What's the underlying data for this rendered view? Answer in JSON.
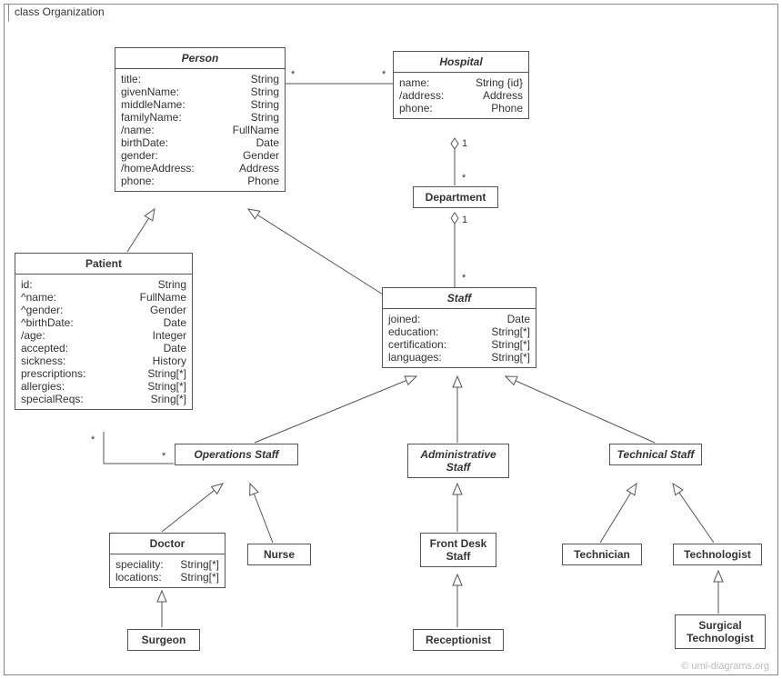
{
  "frame_label": "class Organization",
  "watermark": "© uml-diagrams.org",
  "classes": {
    "person": {
      "name": "Person",
      "attrs": [
        {
          "k": "title:",
          "v": "String"
        },
        {
          "k": "givenName:",
          "v": "String"
        },
        {
          "k": "middleName:",
          "v": "String"
        },
        {
          "k": "familyName:",
          "v": "String"
        },
        {
          "k": "/name:",
          "v": "FullName"
        },
        {
          "k": "birthDate:",
          "v": "Date"
        },
        {
          "k": "gender:",
          "v": "Gender"
        },
        {
          "k": "/homeAddress:",
          "v": "Address"
        },
        {
          "k": "phone:",
          "v": "Phone"
        }
      ]
    },
    "hospital": {
      "name": "Hospital",
      "attrs": [
        {
          "k": "name:",
          "v": "String {id}"
        },
        {
          "k": "/address:",
          "v": "Address"
        },
        {
          "k": "phone:",
          "v": "Phone"
        }
      ]
    },
    "department": {
      "name": "Department"
    },
    "patient": {
      "name": "Patient",
      "attrs": [
        {
          "k": "id:",
          "v": "String"
        },
        {
          "k": "^name:",
          "v": "FullName"
        },
        {
          "k": "^gender:",
          "v": "Gender"
        },
        {
          "k": "^birthDate:",
          "v": "Date"
        },
        {
          "k": "/age:",
          "v": "Integer"
        },
        {
          "k": "accepted:",
          "v": "Date"
        },
        {
          "k": "sickness:",
          "v": "History"
        },
        {
          "k": "prescriptions:",
          "v": "String[*]"
        },
        {
          "k": "allergies:",
          "v": "String[*]"
        },
        {
          "k": "specialReqs:",
          "v": "Sring[*]"
        }
      ]
    },
    "staff": {
      "name": "Staff",
      "attrs": [
        {
          "k": "joined:",
          "v": "Date"
        },
        {
          "k": "education:",
          "v": "String[*]"
        },
        {
          "k": "certification:",
          "v": "String[*]"
        },
        {
          "k": "languages:",
          "v": "String[*]"
        }
      ]
    },
    "opsStaff": {
      "name": "Operations Staff"
    },
    "adminStaff": {
      "name": "Administrative Staff"
    },
    "techStaff": {
      "name": "Technical Staff"
    },
    "doctor": {
      "name": "Doctor",
      "attrs": [
        {
          "k": "speciality:",
          "v": "String[*]"
        },
        {
          "k": "locations:",
          "v": "String[*]"
        }
      ]
    },
    "nurse": {
      "name": "Nurse"
    },
    "frontDesk": {
      "name": "Front Desk Staff"
    },
    "receptionist": {
      "name": "Receptionist"
    },
    "technician": {
      "name": "Technician"
    },
    "technologist": {
      "name": "Technologist"
    },
    "surgTech": {
      "name": "Surgical Technologist"
    }
  },
  "multiplicities": {
    "person_hospital_left": "*",
    "person_hospital_right": "*",
    "hospital_dept_top": "1",
    "hospital_dept_bottom": "*",
    "dept_staff_top": "1",
    "dept_staff_bottom": "*",
    "patient_ops_left": "*",
    "patient_ops_right": "*"
  }
}
